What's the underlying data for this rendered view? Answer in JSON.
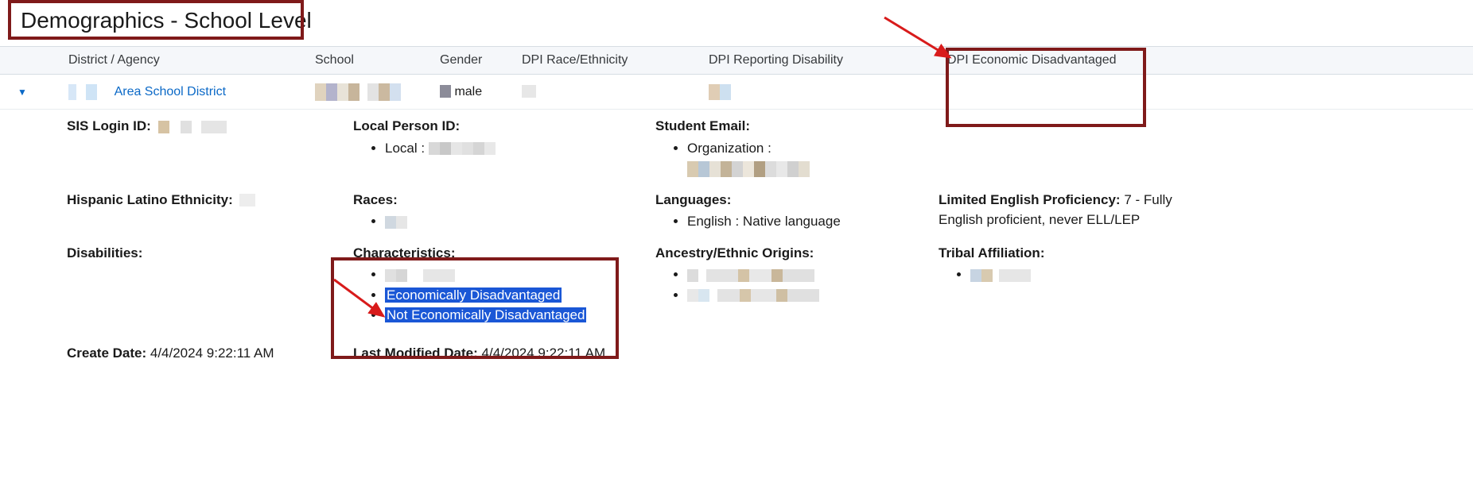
{
  "page": {
    "title": "Demographics - School Level"
  },
  "columns": {
    "district": "District / Agency",
    "school": "School",
    "gender": "Gender",
    "race": "DPI Race/Ethnicity",
    "disability": "DPI Reporting Disability",
    "econ": "DPI Economic Disadvantaged"
  },
  "row": {
    "district_link": "Area School District",
    "gender": "male"
  },
  "details": {
    "sis_login_label": "SIS Login ID:",
    "local_person_label": "Local Person ID:",
    "local_person_item_prefix": "Local : ",
    "student_email_label": "Student Email:",
    "student_email_item_prefix": "Organization :",
    "hispanic_label": "Hispanic Latino Ethnicity:",
    "races_label": "Races:",
    "languages_label": "Languages:",
    "languages_item": "English : Native language",
    "lep_label": "Limited English Proficiency: ",
    "lep_value": "7 - Fully English proficient, never ELL/LEP",
    "disabilities_label": "Disabilities:",
    "characteristics_label": "Characteristics:",
    "char_item2": "Economically Disadvantaged",
    "char_item3": "Not Economically Disadvantaged",
    "ancestry_label": "Ancestry/Ethnic Origins:",
    "tribal_label": "Tribal Affiliation:",
    "create_date_label": "Create Date: ",
    "create_date_value": "4/4/2024 9:22:11 AM",
    "last_mod_label": "Last Modified Date: ",
    "last_mod_value": "4/4/2024 9:22:11 AM"
  }
}
